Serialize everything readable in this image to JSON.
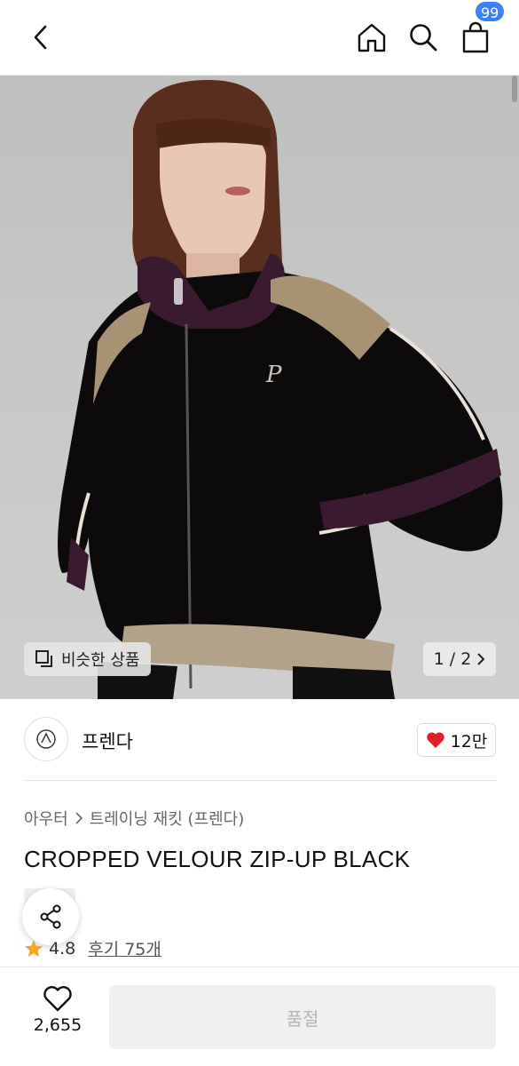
{
  "header": {
    "back_icon": "chevron-left-icon",
    "home_icon": "home-icon",
    "search_icon": "search-icon",
    "cart_icon": "shopping-bag-icon",
    "cart_badge": "99",
    "badge_color": "#3b82f6"
  },
  "hero": {
    "similar_label": "비슷한 상품",
    "pager": "1 / 2"
  },
  "brand": {
    "name": "프렌다",
    "likes": "12만",
    "heart_color": "#e0202a"
  },
  "product": {
    "breadcrumb": [
      "아우터",
      "트레이닝 재킷 (프렌다)"
    ],
    "title": "CROPPED VELOUR ZIP-UP BLACK",
    "rating": "4.8",
    "reviews": "후기 75개",
    "star_color": "#f5a623"
  },
  "bottom": {
    "wish_count": "2,655",
    "soldout_label": "품절"
  }
}
